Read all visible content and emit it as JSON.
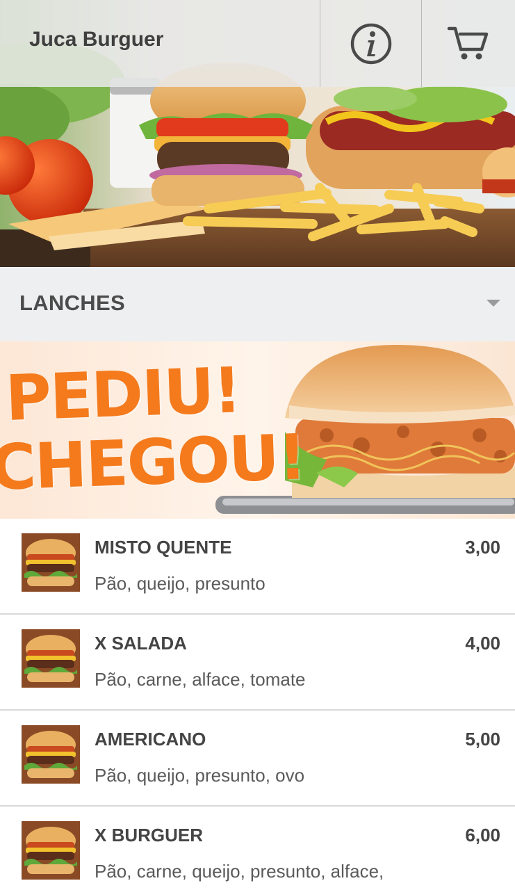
{
  "header": {
    "title": "Juca Burguer",
    "info_icon": "info-icon",
    "cart_icon": "cart-icon"
  },
  "category": {
    "selected": "LANCHES",
    "dropdown_icon": "caret-down-icon"
  },
  "banner": {
    "line1": "PEDIU!",
    "line2": "CHEGOU!"
  },
  "menu": {
    "items": [
      {
        "name": "MISTO QUENTE",
        "description": "Pão, queijo, presunto",
        "price": "3,00"
      },
      {
        "name": "X SALADA",
        "description": "Pão, carne, alface, tomate",
        "price": "4,00"
      },
      {
        "name": "AMERICANO",
        "description": "Pão, queijo, presunto, ovo",
        "price": "5,00"
      },
      {
        "name": "X BURGUER",
        "description": "Pão, carne, queijo, presunto, alface,",
        "price": "6,00"
      }
    ]
  },
  "colors": {
    "header_overlay": "#e8e9e9",
    "title_text": "#3f3f3f",
    "category_bg": "#eeeff0",
    "banner_orange": "#f47a1c",
    "divider": "#d9d9d9"
  }
}
